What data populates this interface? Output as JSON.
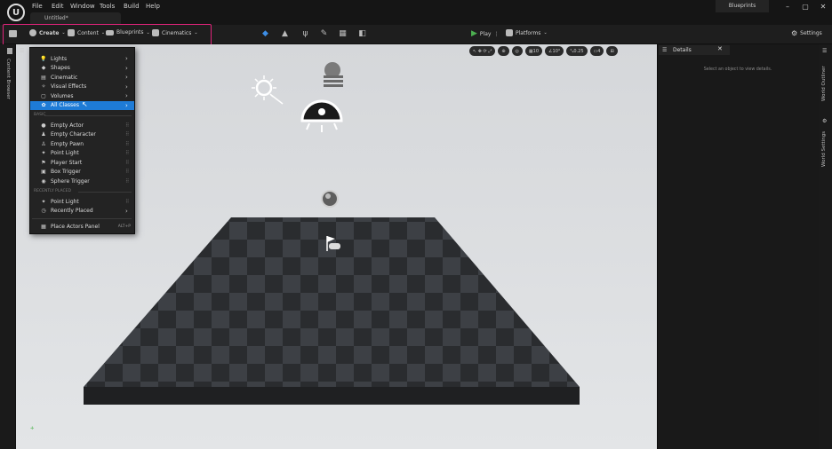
{
  "menubar": {
    "logo": "U",
    "items": [
      "File",
      "Edit",
      "Window",
      "Tools",
      "Build",
      "Help"
    ],
    "document_tab": "Untitled*",
    "blueprints_tab": "Blueprints",
    "window_buttons": [
      "–",
      "▢",
      "✕"
    ]
  },
  "toolbar": {
    "create": "Create",
    "content": "Content",
    "blueprints": "Blueprints",
    "cinematics": "Cinematics",
    "play": "Play",
    "platforms": "Platforms",
    "settings": "Settings",
    "highlight_color": "#e0247a"
  },
  "viewport": {
    "tools": [
      "10",
      "10°",
      "0.25",
      "4"
    ]
  },
  "create_menu": {
    "categories": [
      {
        "label": "Lights",
        "icon": "light-icon"
      },
      {
        "label": "Shapes",
        "icon": "shapes-icon"
      },
      {
        "label": "Cinematic",
        "icon": "cinematic-icon"
      },
      {
        "label": "Visual Effects",
        "icon": "visual-effects-icon"
      },
      {
        "label": "Volumes",
        "icon": "volume-icon"
      },
      {
        "label": "All Classes",
        "icon": "all-classes-icon"
      }
    ],
    "basic_header": "BASIC",
    "basic": [
      "Empty Actor",
      "Empty Character",
      "Empty Pawn",
      "Point Light",
      "Player Start",
      "Box Trigger",
      "Sphere Trigger"
    ],
    "recent_header": "RECENTLY PLACED",
    "recent": [
      "Point Light",
      "Recently Placed"
    ],
    "place_actors": "Place Actors Panel",
    "place_actors_shortcut": "ALT+P",
    "selected_color": "#1e7bd6"
  },
  "side_panels": {
    "left": "Content Browser",
    "right_top": "World Outliner",
    "right_bottom": "World Settings"
  },
  "details": {
    "tab": "Details",
    "empty_text": "Select an object to view details."
  }
}
